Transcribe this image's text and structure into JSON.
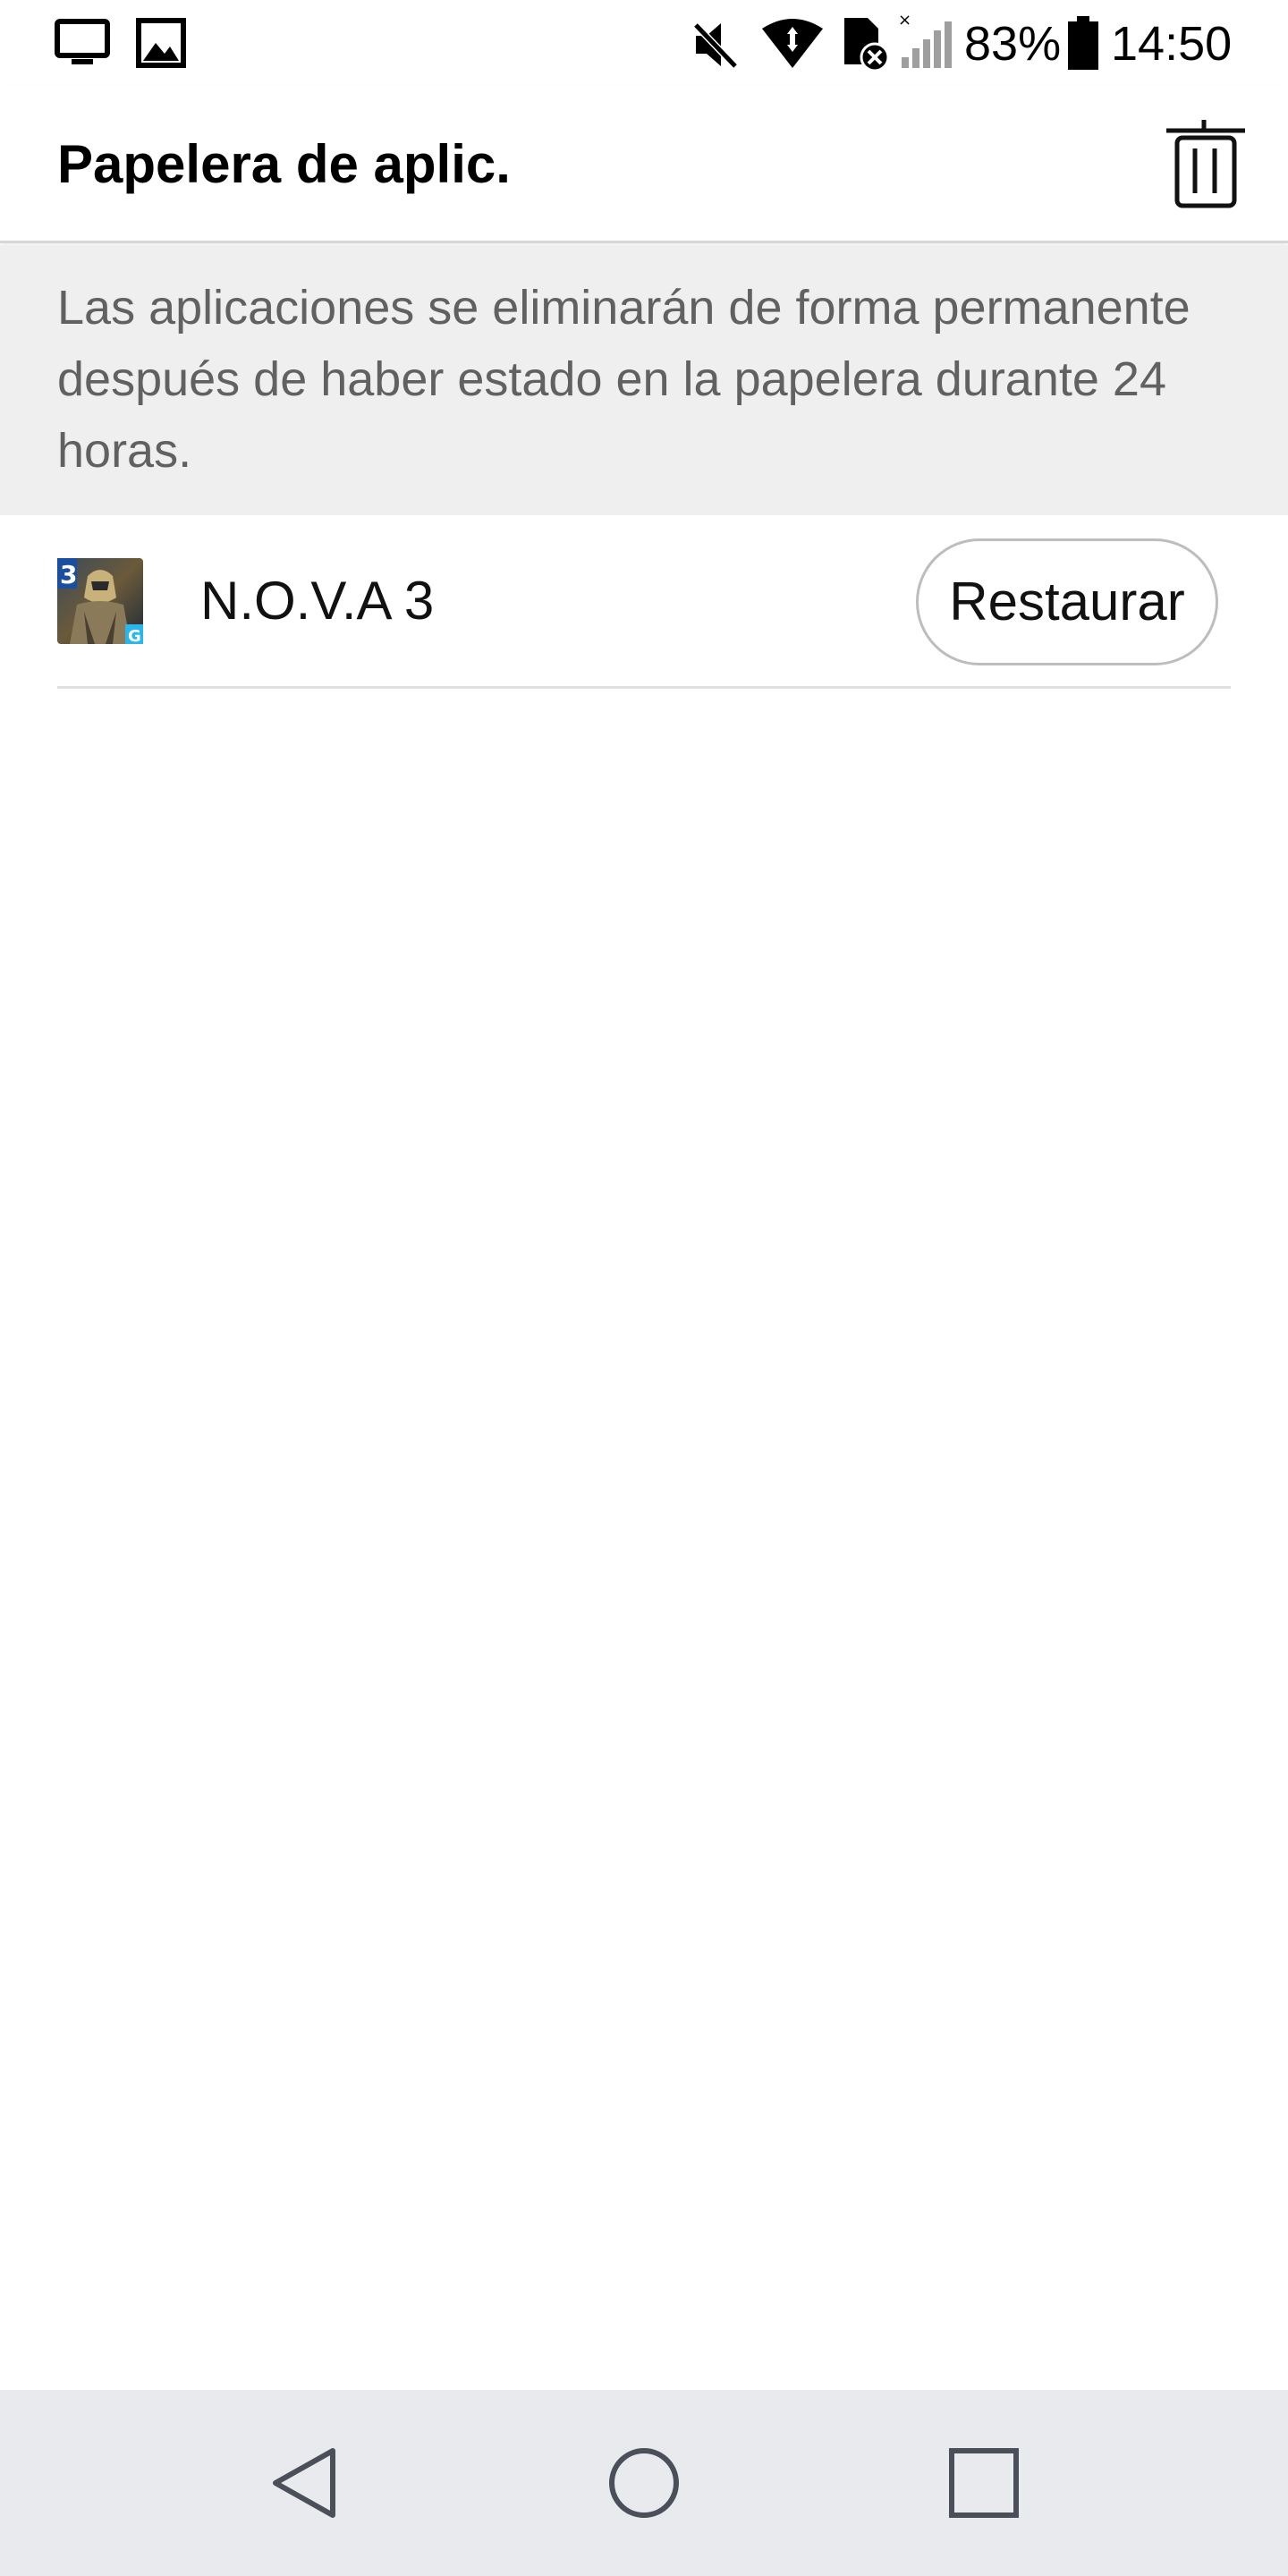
{
  "status_bar": {
    "icons": [
      "screen-cast-icon",
      "gallery-icon",
      "mute-icon",
      "wifi-icon",
      "sim-error-icon",
      "signal-icon",
      "battery-icon"
    ],
    "battery": "83%",
    "time": "14:50"
  },
  "app_bar": {
    "title": "Papelera de aplic.",
    "action_icon": "trash-icon"
  },
  "info": {
    "text": "Las aplicaciones se eliminarán de forma permanente después de haber estado en la papelera durante 24 horas."
  },
  "apps": [
    {
      "name": "N.O.V.A 3",
      "icon": "nova3-app-icon",
      "action_label": "Restaurar"
    }
  ],
  "nav_bar": {
    "buttons": [
      "back-icon",
      "home-icon",
      "recents-icon"
    ]
  },
  "colors": {
    "info_background": "#efefef",
    "info_text": "#616161",
    "nav_background": "#e9eaee",
    "divider": "#e0e0e0"
  }
}
